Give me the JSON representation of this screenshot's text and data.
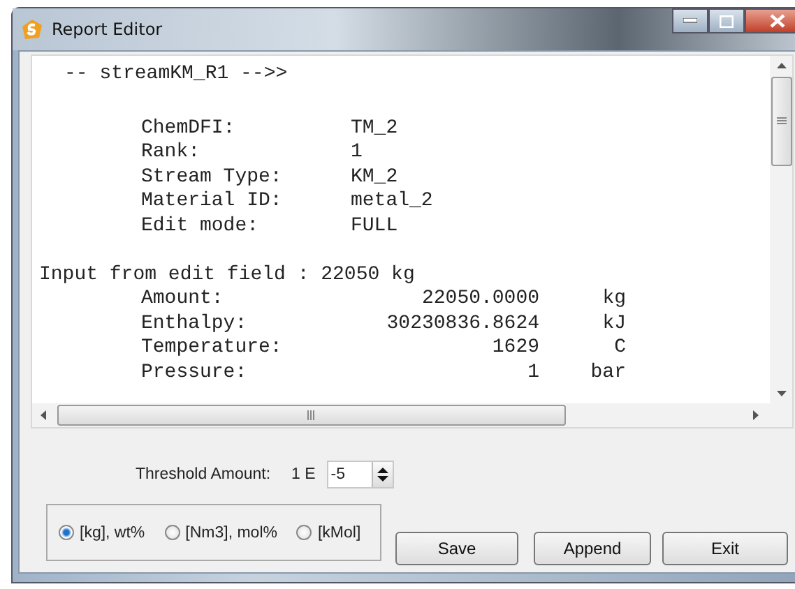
{
  "window": {
    "title": "Report Editor"
  },
  "report": {
    "header": "-- streamKM_R1 -->>",
    "fields": [
      {
        "label": "ChemDFI:",
        "value": "TM_2"
      },
      {
        "label": "Rank:",
        "value": "1"
      },
      {
        "label": "Stream Type:",
        "value": "KM_2"
      },
      {
        "label": "Material ID:",
        "value": "metal_2"
      },
      {
        "label": "Edit mode:",
        "value": "FULL"
      }
    ],
    "input_line": "Input from edit field : 22050 kg",
    "quantities": [
      {
        "label": "Amount:",
        "value": "22050.0000",
        "unit": "kg"
      },
      {
        "label": "Enthalpy:",
        "value": "30230836.8624",
        "unit": "kJ"
      },
      {
        "label": "Temperature:",
        "value": "1629",
        "unit": "C"
      },
      {
        "label": "Pressure:",
        "value": "1",
        "unit": "bar"
      }
    ]
  },
  "threshold": {
    "label": "Threshold Amount:",
    "prefix": "1 E",
    "value": "-5"
  },
  "units": [
    {
      "label": "[kg], wt%",
      "selected": true
    },
    {
      "label": "[Nm3], mol%",
      "selected": false
    },
    {
      "label": "[kMol]",
      "selected": false
    }
  ],
  "buttons": [
    "Save",
    "Append",
    "Exit"
  ]
}
